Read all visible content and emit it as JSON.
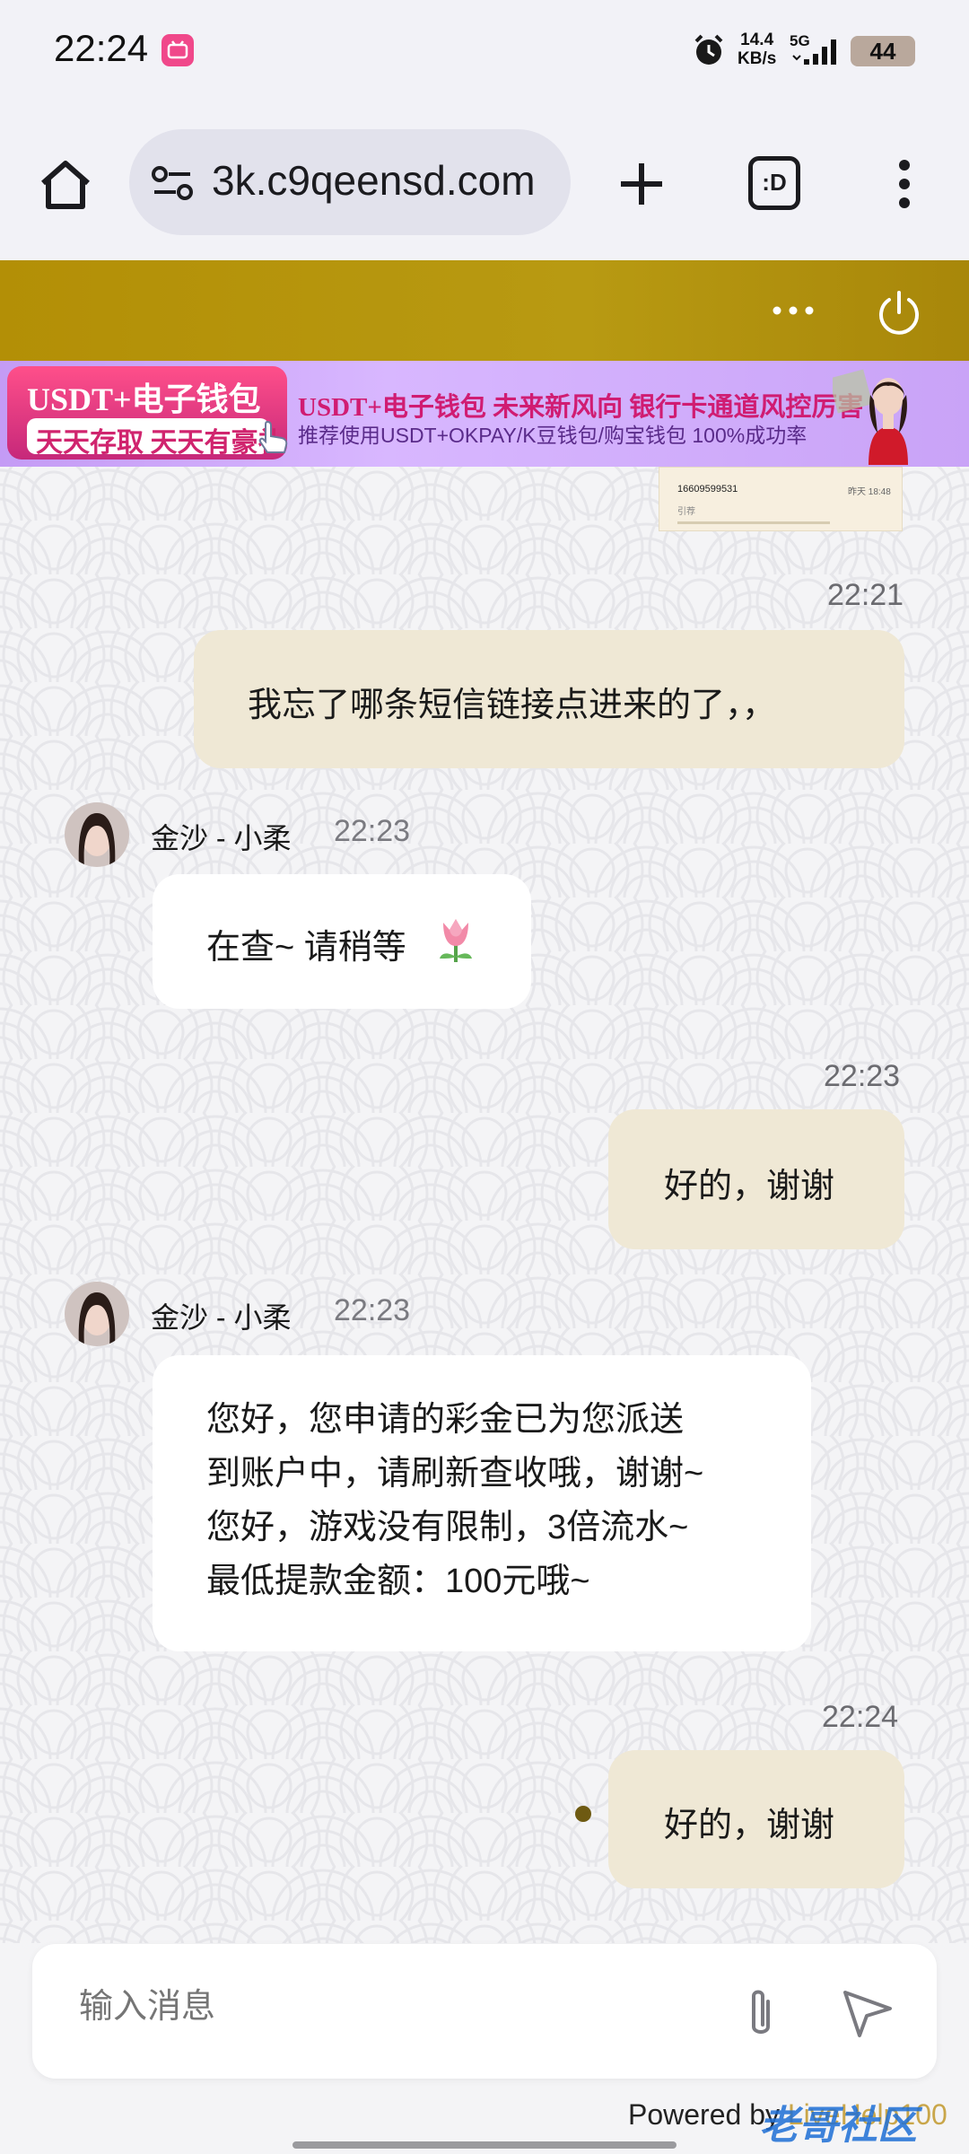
{
  "status_bar": {
    "time": "22:24",
    "net_speed_value": "14.4",
    "net_speed_unit": "KB/s",
    "network": "5G",
    "battery": "44"
  },
  "browser": {
    "url": "3k.c9qeensd.com",
    "tabs_label": ":D"
  },
  "banner": {
    "left_line1": "USDT+电子钱包",
    "left_line2": "天天存取 天天有豪礼",
    "main_text": "USDT+电子钱包  未来新风向  银行卡通道风控厉害",
    "sub_text": "推荐使用USDT+OKPAY/K豆钱包/购宝钱包  100%成功率"
  },
  "quoted": {
    "phone": "16609599531",
    "time": "昨天 18:48",
    "sub": "引荐"
  },
  "messages": {
    "m1": {
      "time": "22:21",
      "text": "我忘了哪条短信链接点进来的了，，"
    },
    "m2": {
      "sender": "金沙 - 小柔",
      "time": "22:23",
      "text": "在查~ 请稍等"
    },
    "m3": {
      "time": "22:23",
      "text": "好的，谢谢"
    },
    "m4": {
      "sender": "金沙 - 小柔",
      "time": "22:23",
      "lines": [
        "您好，您申请的彩金已为您派送",
        "到账户中，请刷新查收哦，谢谢~",
        "您好，游戏没有限制，3倍流水~",
        "最低提款金额：100元哦~"
      ]
    },
    "m5": {
      "time": "22:24",
      "text": "好的，谢谢"
    }
  },
  "composer": {
    "placeholder": "输入消息"
  },
  "footer": {
    "powered_prefix": "Powered by ",
    "powered_link": "LiveHelp100",
    "watermark": "老哥社区"
  },
  "colors": {
    "header_gold": "#b38f06",
    "bubble_out": "#efe8d5",
    "bubble_in": "#ffffff"
  }
}
